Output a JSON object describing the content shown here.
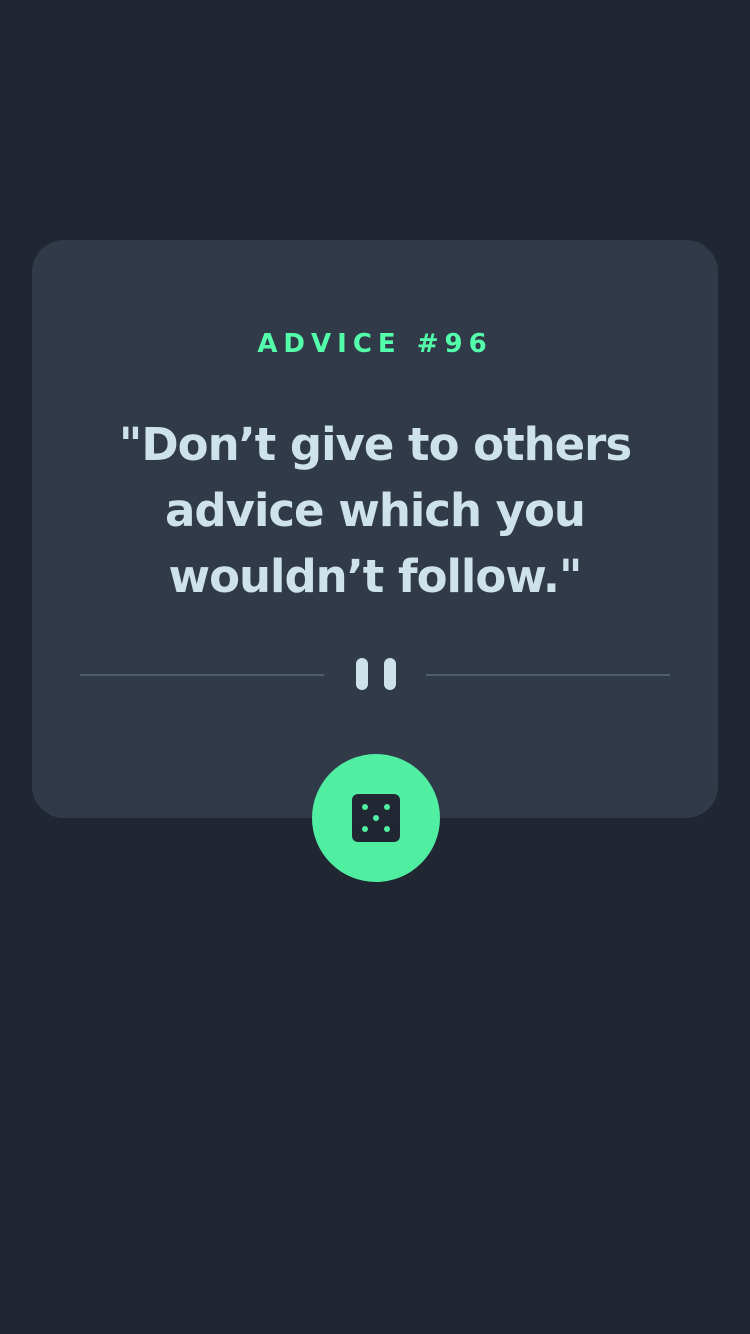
{
  "advice": {
    "label": "ADVICE #96",
    "quote": "\"Don’t give to others advice which you wouldn’t follow.\""
  },
  "divider": {
    "icon": "pause-icon"
  },
  "action": {
    "icon": "dice-icon"
  },
  "colors": {
    "background": "#202733",
    "card": "#313A48",
    "accent": "#53FFAA",
    "text": "#CEE3E9",
    "divider": "#4F5D74"
  }
}
